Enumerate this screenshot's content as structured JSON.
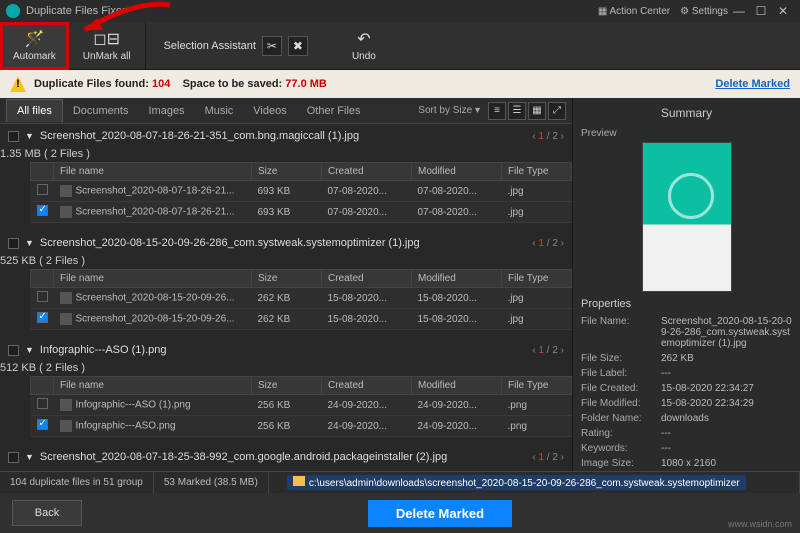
{
  "title": "Duplicate Files Fixer",
  "titlebar": {
    "action_center": "Action Center",
    "settings": "Settings"
  },
  "toolbar": {
    "automark": "Automark",
    "unmark_all": "UnMark all",
    "selection_assistant": "Selection Assistant",
    "undo": "Undo"
  },
  "stats": {
    "found_label": "Duplicate Files found:",
    "found_value": "104",
    "space_label": "Space to be saved:",
    "space_value": "77.0 MB",
    "delete_marked": "Delete Marked"
  },
  "tabs": {
    "items": [
      "All files",
      "Documents",
      "Images",
      "Music",
      "Videos",
      "Other Files"
    ],
    "sort": "Sort by Size ▾"
  },
  "groups": [
    {
      "name": "Screenshot_2020-08-07-18-26-21-351_com.bng.magiccall (1).jpg",
      "sub": "1.35 MB  ( 2 Files )",
      "page_cur": "1",
      "page_total": "2",
      "rows": [
        {
          "checked": false,
          "name": "Screenshot_2020-08-07-18-26-21...",
          "size": "693 KB",
          "created": "07-08-2020...",
          "modified": "07-08-2020...",
          "type": ".jpg"
        },
        {
          "checked": true,
          "name": "Screenshot_2020-08-07-18-26-21...",
          "size": "693 KB",
          "created": "07-08-2020...",
          "modified": "07-08-2020...",
          "type": ".jpg"
        }
      ]
    },
    {
      "name": "Screenshot_2020-08-15-20-09-26-286_com.systweak.systemoptimizer (1).jpg",
      "sub": "525 KB  ( 2 Files )",
      "page_cur": "1",
      "page_total": "2",
      "rows": [
        {
          "checked": false,
          "name": "Screenshot_2020-08-15-20-09-26...",
          "size": "262 KB",
          "created": "15-08-2020...",
          "modified": "15-08-2020...",
          "type": ".jpg"
        },
        {
          "checked": true,
          "name": "Screenshot_2020-08-15-20-09-26...",
          "size": "262 KB",
          "created": "15-08-2020...",
          "modified": "15-08-2020...",
          "type": ".jpg"
        }
      ]
    },
    {
      "name": "Infographic---ASO (1).png",
      "sub": "512 KB  ( 2 Files )",
      "page_cur": "1",
      "page_total": "2",
      "rows": [
        {
          "checked": false,
          "name": "Infographic---ASO (1).png",
          "size": "256 KB",
          "created": "24-09-2020...",
          "modified": "24-09-2020...",
          "type": ".png"
        },
        {
          "checked": true,
          "name": "Infographic---ASO.png",
          "size": "256 KB",
          "created": "24-09-2020...",
          "modified": "24-09-2020...",
          "type": ".png"
        }
      ]
    },
    {
      "name": "Screenshot_2020-08-07-18-25-38-992_com.google.android.packageinstaller (2).jpg",
      "sub": "",
      "page_cur": "1",
      "page_total": "2",
      "rows": []
    }
  ],
  "columns": {
    "c1": "File name",
    "c2": "Size",
    "c3": "Created",
    "c4": "Modified",
    "c5": "File Type"
  },
  "right": {
    "summary": "Summary",
    "preview": "Preview",
    "properties": "Properties",
    "rows": [
      {
        "k": "File Name:",
        "v": "Screenshot_2020-08-15-20-09-26-286_com.systweak.systemoptimizer (1).jpg"
      },
      {
        "k": "File Size:",
        "v": "262 KB"
      },
      {
        "k": "File Label:",
        "v": "---"
      },
      {
        "k": "File Created:",
        "v": "15-08-2020 22:34:27"
      },
      {
        "k": "File Modified:",
        "v": "15-08-2020 22:34:29"
      },
      {
        "k": "Folder Name:",
        "v": "downloads"
      },
      {
        "k": "Rating:",
        "v": "---"
      },
      {
        "k": "Keywords:",
        "v": "---"
      },
      {
        "k": "Image Size:",
        "v": "1080 x 2160"
      }
    ]
  },
  "status": {
    "dup": "104 duplicate files in 51 group",
    "marked": "53 Marked (38.5 MB)",
    "path": "c:\\users\\admin\\downloads\\screenshot_2020-08-15-20-09-26-286_com.systweak.systemoptimizer"
  },
  "bottom": {
    "back": "Back",
    "delete": "Delete Marked"
  },
  "watermark": "www.wsidn.com"
}
